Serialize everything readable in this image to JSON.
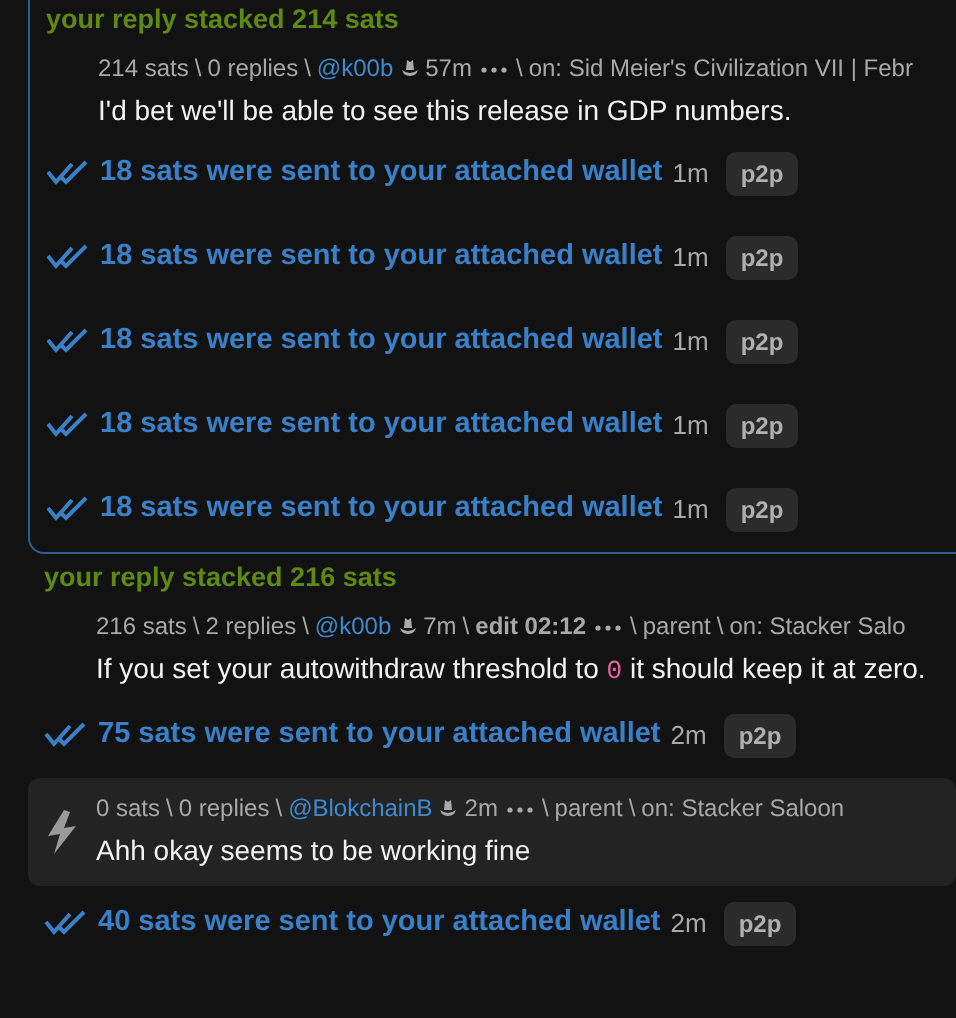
{
  "sections": [
    {
      "boxed": true,
      "items": [
        {
          "kind": "stacked",
          "title": "your reply stacked 214 sats"
        },
        {
          "kind": "comment",
          "card": false,
          "meta": [
            {
              "kind": "sats",
              "text": "214 sats"
            },
            {
              "kind": "sep",
              "text": "\\"
            },
            {
              "kind": "replies",
              "text": "0 replies"
            },
            {
              "kind": "sep",
              "text": "\\"
            },
            {
              "kind": "user",
              "text": "@k00b"
            },
            {
              "kind": "hat"
            },
            {
              "kind": "time",
              "text": "57m"
            },
            {
              "kind": "more"
            },
            {
              "kind": "sep",
              "text": "\\"
            },
            {
              "kind": "on",
              "text": "on: Sid Meier's Civilization VII | Febr"
            }
          ],
          "text": "I'd bet we'll be able to see this release in GDP numbers."
        },
        {
          "kind": "payment",
          "text": "18 sats were sent to your attached wallet",
          "time": "1m",
          "badge": "p2p"
        },
        {
          "kind": "payment",
          "text": "18 sats were sent to your attached wallet",
          "time": "1m",
          "badge": "p2p"
        },
        {
          "kind": "payment",
          "text": "18 sats were sent to your attached wallet",
          "time": "1m",
          "badge": "p2p"
        },
        {
          "kind": "payment",
          "text": "18 sats were sent to your attached wallet",
          "time": "1m",
          "badge": "p2p"
        },
        {
          "kind": "payment",
          "text": "18 sats were sent to your attached wallet",
          "time": "1m",
          "badge": "p2p"
        }
      ]
    },
    {
      "boxed": false,
      "items": [
        {
          "kind": "stacked",
          "title": "your reply stacked 216 sats"
        },
        {
          "kind": "comment",
          "card": false,
          "meta": [
            {
              "kind": "sats",
              "text": "216 sats"
            },
            {
              "kind": "sep",
              "text": "\\"
            },
            {
              "kind": "replies",
              "text": "2 replies"
            },
            {
              "kind": "sep",
              "text": "\\"
            },
            {
              "kind": "user",
              "text": "@k00b"
            },
            {
              "kind": "hat"
            },
            {
              "kind": "time",
              "text": "7m"
            },
            {
              "kind": "sep",
              "text": "\\"
            },
            {
              "kind": "edit",
              "text": "edit 02:12"
            },
            {
              "kind": "more"
            },
            {
              "kind": "sep",
              "text": "\\"
            },
            {
              "kind": "parent",
              "text": "parent"
            },
            {
              "kind": "sep",
              "text": "\\"
            },
            {
              "kind": "on",
              "text": "on: Stacker Salo"
            }
          ],
          "text": "If you set your autowithdraw threshold to ",
          "code": "0",
          "text_end": " it should keep it at zero."
        },
        {
          "kind": "payment",
          "text": "75 sats were sent to your attached wallet",
          "time": "2m",
          "badge": "p2p"
        },
        {
          "kind": "comment",
          "card": true,
          "meta": [
            {
              "kind": "sats",
              "text": "0 sats"
            },
            {
              "kind": "sep",
              "text": "\\"
            },
            {
              "kind": "replies",
              "text": "0 replies"
            },
            {
              "kind": "sep",
              "text": "\\"
            },
            {
              "kind": "user",
              "text": "@BlokchainB"
            },
            {
              "kind": "hat"
            },
            {
              "kind": "time",
              "text": "2m"
            },
            {
              "kind": "more"
            },
            {
              "kind": "sep",
              "text": "\\"
            },
            {
              "kind": "parent",
              "text": "parent"
            },
            {
              "kind": "sep",
              "text": "\\"
            },
            {
              "kind": "on",
              "text": "on: Stacker Saloon"
            }
          ],
          "text": "Ahh okay seems to be working fine"
        },
        {
          "kind": "payment",
          "text": "40 sats were sent to your attached wallet",
          "time": "2m",
          "badge": "p2p"
        }
      ]
    }
  ]
}
